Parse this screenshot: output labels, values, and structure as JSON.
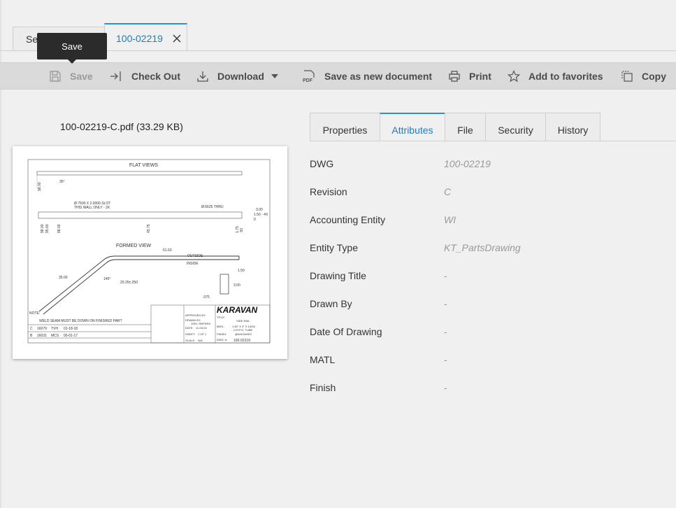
{
  "tabs": [
    {
      "label": "Se"
    },
    {
      "label": "100-02219"
    }
  ],
  "tooltip": "Save",
  "toolbar": {
    "save": "Save",
    "check_out": "Check Out",
    "download": "Download",
    "save_as_new": "Save as new document",
    "print": "Print",
    "add_favorites": "Add to favorites",
    "copy": "Copy"
  },
  "preview": {
    "file_label": "100-02219-C.pdf  (33.29 KB)",
    "drawing": {
      "flat_views": "FLAT VIEWS",
      "formed_view": "FORMED VIEW",
      "slot": "Ø.7500 X 2.0000 SLOT",
      "wall": "THIS WALL ONLY - 3X",
      "thru": "Ø.5625 THRU",
      "outside": "OUTSIDE",
      "inside": "INSIDE",
      "note": "NOTE:",
      "weld": "WELD SEAM MUST BE DOWN ON FINISHED PART",
      "logo": "KARAVAN",
      "title_label": "TITLE:",
      "title_value": "SIDE RAIL",
      "matl_label": "MATL:",
      "matl_value": "1.50\" X 3\" X 14GA",
      "matl_value2": "H.R.P.O. TUBE",
      "finish_label": "FINISH:",
      "finish_value": "@WILDWINT",
      "dwg_label": "DWG. #:",
      "dwg_value": "100-02219",
      "dim_35": "35°",
      "dim_6163": "61.63",
      "dim_3500": "35.00",
      "dim_145": "145°",
      "dim_2025": "20.25±.250",
      "dim_150": "1.50",
      "dim_300": "3.00",
      "dim_075": ".075",
      "dim_300b": "3.00",
      "dim_150b": "1.50 - 4X",
      "dim_98": "98.00",
      "dim_4575": "45.75",
      "dim_9800": "98.00",
      "dim_9560": "95.60",
      "dim_8800": "88.00",
      "dim_175": "1.75",
      "dim_50": ".50",
      "dim_0": "0",
      "rev_c": "C",
      "rev_c_ecn": "16079",
      "rev_c_by": "TVH",
      "rev_c_date": "01-18-18",
      "rev_b": "B",
      "rev_b_ecn": "16031",
      "rev_b_by": "MCS",
      "rev_b_date": "05-01-17",
      "approved": "APPROVED BY:",
      "drawn": "DRAWN BY:",
      "drawn_value": "JOEL SEIFERS",
      "date_label": "DATE:",
      "date_value": "11-03-04",
      "sheet": "SHEET:",
      "sheet_value": "1 OF 1",
      "scale": "SCALE:",
      "scale_value": "N/A"
    }
  },
  "property_tabs": [
    "Properties",
    "Attributes",
    "File",
    "Security",
    "History"
  ],
  "attributes": [
    {
      "label": "DWG",
      "value": "100-02219"
    },
    {
      "label": "Revision",
      "value": "C"
    },
    {
      "label": "Accounting Entity",
      "value": "WI"
    },
    {
      "label": "Entity Type",
      "value": "KT_PartsDrawing"
    },
    {
      "label": "Drawing Title",
      "value": "-"
    },
    {
      "label": "Drawn By",
      "value": "-"
    },
    {
      "label": "Date Of Drawing",
      "value": "-"
    },
    {
      "label": "MATL",
      "value": "-"
    },
    {
      "label": "Finish",
      "value": "-"
    }
  ],
  "colors": {
    "accent": "#1e7cc0",
    "toolbar": "#dadada",
    "background": "#f0f0f0"
  }
}
